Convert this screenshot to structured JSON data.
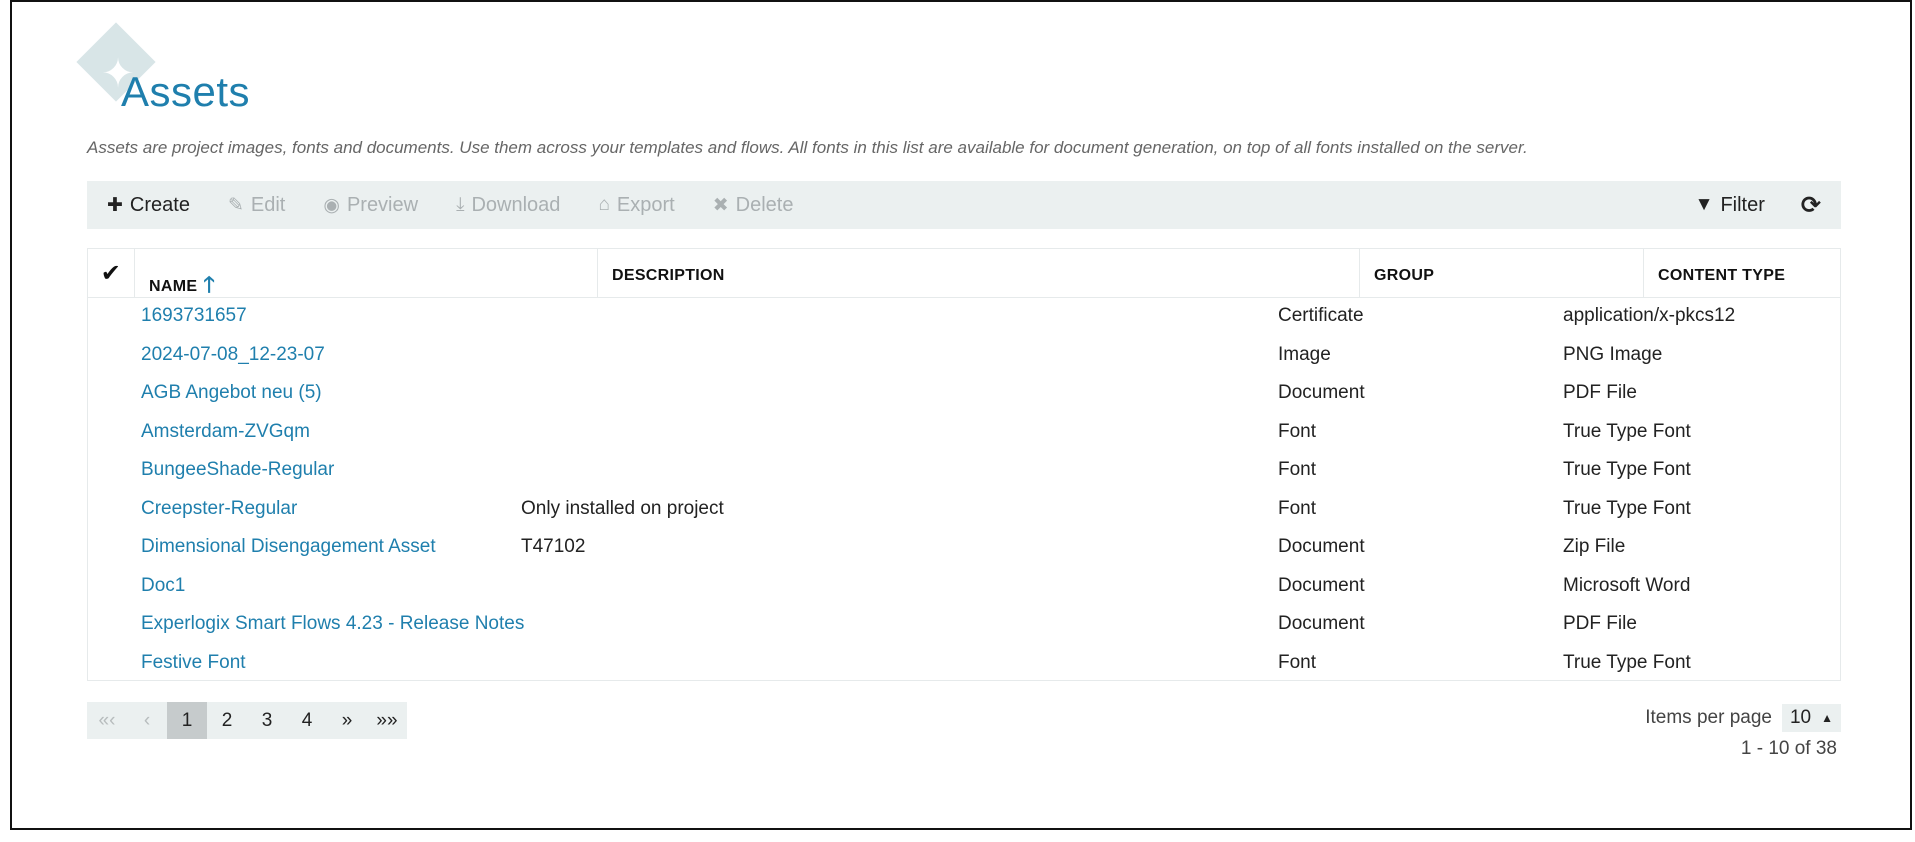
{
  "page": {
    "title": "Assets",
    "description": "Assets are project images, fonts and documents. Use them across your templates and flows. All fonts in this list are available for document generation, on top of all fonts installed on the server."
  },
  "toolbar": {
    "create": "Create",
    "edit": "Edit",
    "preview": "Preview",
    "download": "Download",
    "export": "Export",
    "delete": "Delete",
    "filter": "Filter"
  },
  "table": {
    "headers": {
      "name": "NAME",
      "description": "DESCRIPTION",
      "group": "GROUP",
      "content_type": "CONTENT TYPE"
    },
    "rows": [
      {
        "name": "1693731657",
        "description": "",
        "group": "Certificate",
        "content_type": "application/x-pkcs12"
      },
      {
        "name": "2024-07-08_12-23-07",
        "description": "",
        "group": "Image",
        "content_type": "PNG Image"
      },
      {
        "name": "AGB Angebot neu (5)",
        "description": "",
        "group": "Document",
        "content_type": "PDF File"
      },
      {
        "name": "Amsterdam-ZVGqm",
        "description": "",
        "group": "Font",
        "content_type": "True Type Font"
      },
      {
        "name": "BungeeShade-Regular",
        "description": "",
        "group": "Font",
        "content_type": "True Type Font"
      },
      {
        "name": "Creepster-Regular",
        "description": "Only installed on project",
        "group": "Font",
        "content_type": "True Type Font"
      },
      {
        "name": "Dimensional Disengagement Asset",
        "description": "T47102",
        "group": "Document",
        "content_type": "Zip File"
      },
      {
        "name": "Doc1",
        "description": "",
        "group": "Document",
        "content_type": "Microsoft Word"
      },
      {
        "name": "Experlogix Smart Flows 4.23 - Release Notes",
        "description": "",
        "group": "Document",
        "content_type": "PDF File"
      },
      {
        "name": "Festive Font",
        "description": "",
        "group": "Font",
        "content_type": "True Type Font"
      }
    ]
  },
  "pagination": {
    "first": "«‹",
    "prev": "‹",
    "pages": [
      "1",
      "2",
      "3",
      "4"
    ],
    "current": "1",
    "next": "»",
    "last": "»»",
    "items_per_page_label": "Items per page",
    "items_per_page_value": "10",
    "range_text": "1 - 10 of 38"
  },
  "icons": {
    "create": "plus-icon",
    "edit": "pencil-icon",
    "preview": "eye-icon",
    "download": "download-icon",
    "export": "export-icon",
    "delete": "x-icon",
    "filter": "funnel-icon",
    "refresh": "refresh-icon",
    "select_all": "checkmark-icon",
    "sort": "arrow-up-icon"
  },
  "colors": {
    "accent": "#1f7fad",
    "toolbar_bg": "#ebf0f0",
    "disabled": "#aab0b2"
  }
}
